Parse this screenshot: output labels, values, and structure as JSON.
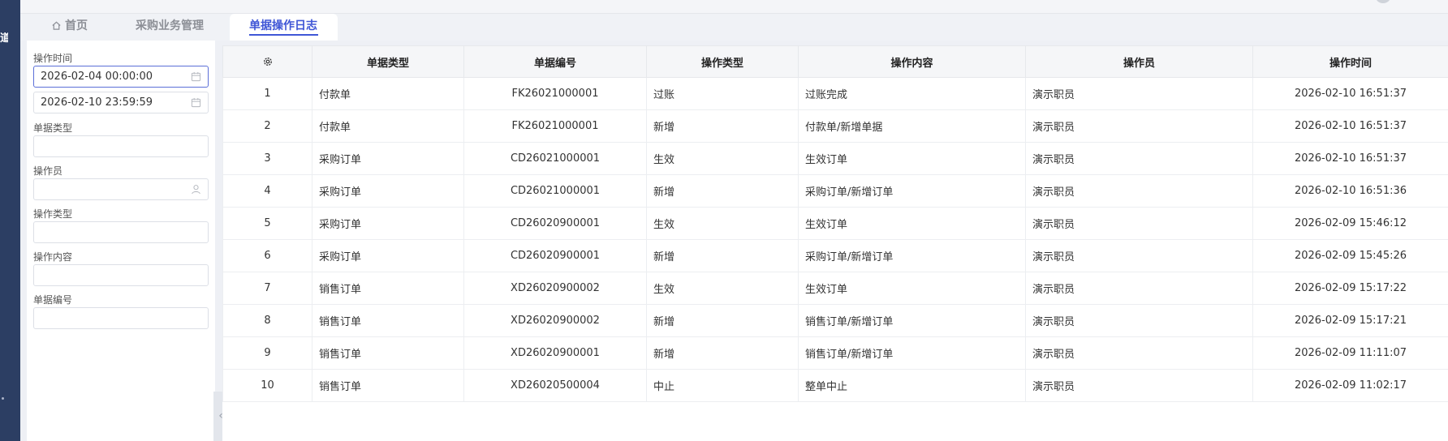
{
  "nav": {
    "char": "道"
  },
  "tabs": [
    {
      "label": "首页",
      "icon": "home-icon"
    },
    {
      "label": "采购业务管理"
    },
    {
      "label": "单据操作日志",
      "active": true
    }
  ],
  "filters": {
    "op_time_label": "操作时间",
    "op_time_start": "2026-02-04 00:00:00",
    "op_time_end": "2026-02-10 23:59:59",
    "doc_type_label": "单据类型",
    "doc_type_value": "",
    "operator_label": "操作员",
    "operator_value": "",
    "op_type_label": "操作类型",
    "op_type_value": "",
    "op_content_label": "操作内容",
    "op_content_value": "",
    "doc_no_label": "单据编号",
    "doc_no_value": ""
  },
  "table": {
    "settings_icon": "gear-icon",
    "columns": [
      "单据类型",
      "单据编号",
      "操作类型",
      "操作内容",
      "操作员",
      "操作时间"
    ],
    "rows": [
      [
        "1",
        "付款单",
        "FK26021000001",
        "过账",
        "过账完成",
        "演示职员",
        "2026-02-10 16:51:37"
      ],
      [
        "2",
        "付款单",
        "FK26021000001",
        "新增",
        "付款单/新增单据",
        "演示职员",
        "2026-02-10 16:51:37"
      ],
      [
        "3",
        "采购订单",
        "CD26021000001",
        "生效",
        "生效订单",
        "演示职员",
        "2026-02-10 16:51:37"
      ],
      [
        "4",
        "采购订单",
        "CD26021000001",
        "新增",
        "采购订单/新增订单",
        "演示职员",
        "2026-02-10 16:51:36"
      ],
      [
        "5",
        "采购订单",
        "CD26020900001",
        "生效",
        "生效订单",
        "演示职员",
        "2026-02-09 15:46:12"
      ],
      [
        "6",
        "采购订单",
        "CD26020900001",
        "新增",
        "采购订单/新增订单",
        "演示职员",
        "2026-02-09 15:45:26"
      ],
      [
        "7",
        "销售订单",
        "XD26020900002",
        "生效",
        "生效订单",
        "演示职员",
        "2026-02-09 15:17:22"
      ],
      [
        "8",
        "销售订单",
        "XD26020900002",
        "新增",
        "销售订单/新增订单",
        "演示职员",
        "2026-02-09 15:17:21"
      ],
      [
        "9",
        "销售订单",
        "XD26020900001",
        "新增",
        "销售订单/新增订单",
        "演示职员",
        "2026-02-09 11:11:07"
      ],
      [
        "10",
        "销售订单",
        "XD26020500004",
        "中止",
        "整单中止",
        "演示职员",
        "2026-02-09 11:02:17"
      ]
    ]
  },
  "collapse_icon": "chevron-left-icon",
  "collapse_glyph": "‹"
}
